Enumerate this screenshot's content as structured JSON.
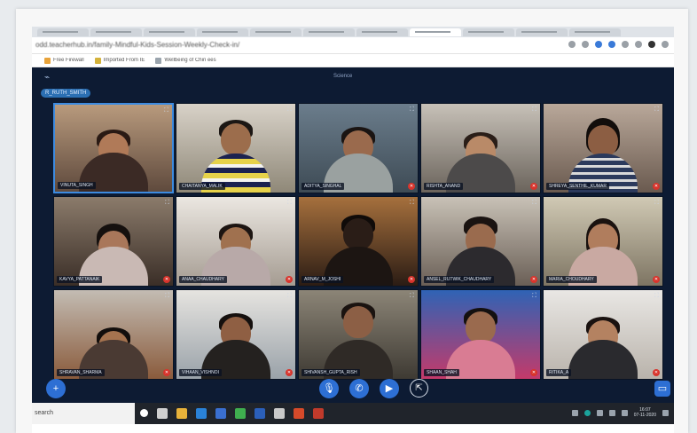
{
  "browser": {
    "url": "odd.teacherhub.in/family-Mindful-Kids-Session-Weekly-Check-in/",
    "bookmarks": [
      {
        "label": "Free Firewall",
        "icon": "bookmark-icon"
      },
      {
        "label": "Imported From IE",
        "icon": "folder-icon"
      },
      {
        "label": "Wellbeing of Chin ees",
        "icon": "page-icon"
      }
    ]
  },
  "meeting": {
    "room_title": "Science",
    "presenter_chip": "R_RUTH_SMITH",
    "participants": [
      {
        "name": "VINUTA_SINGH",
        "active": true,
        "muted": false
      },
      {
        "name": "CHAITANYA_MALIK",
        "active": false,
        "muted": false
      },
      {
        "name": "ADITYA_SINGHAL",
        "active": false,
        "muted": true
      },
      {
        "name": "RISHTA_ANAND",
        "active": false,
        "muted": true
      },
      {
        "name": "SHREYA_SENTHIL_KUMAR",
        "active": false,
        "muted": true
      },
      {
        "name": "KAVYA_PATTANAIK",
        "active": false,
        "muted": true
      },
      {
        "name": "ANAA_CHAUDHARY",
        "active": false,
        "muted": true
      },
      {
        "name": "ARNAV_M_JOSHI",
        "active": false,
        "muted": true
      },
      {
        "name": "ANSEL_RUTWIK_CHAUDHARY",
        "active": false,
        "muted": true
      },
      {
        "name": "MARIA_CHOUDHARY",
        "active": false,
        "muted": true
      },
      {
        "name": "SHRAVAN_SHARMA",
        "active": false,
        "muted": true
      },
      {
        "name": "VIHAAN_VISHNOI",
        "active": false,
        "muted": true
      },
      {
        "name": "SHIVANSH_GUPTA_RISH",
        "active": false,
        "muted": false
      },
      {
        "name": "SHAAN_SHAH",
        "active": false,
        "muted": true
      },
      {
        "name": "RITIKA_A",
        "active": false,
        "muted": true
      }
    ]
  },
  "controls": {
    "add": "+",
    "mic": "🎙",
    "phone": "✆",
    "camera": "▶",
    "share": "⇱",
    "chat": "▭"
  },
  "taskbar": {
    "search_text": "search",
    "clock_time": "16:07",
    "clock_date": "07-11-2020"
  },
  "colors": {
    "app_bg": "#0d1b33",
    "accent": "#2d6fd4",
    "muted_badge": "#d8342c"
  }
}
